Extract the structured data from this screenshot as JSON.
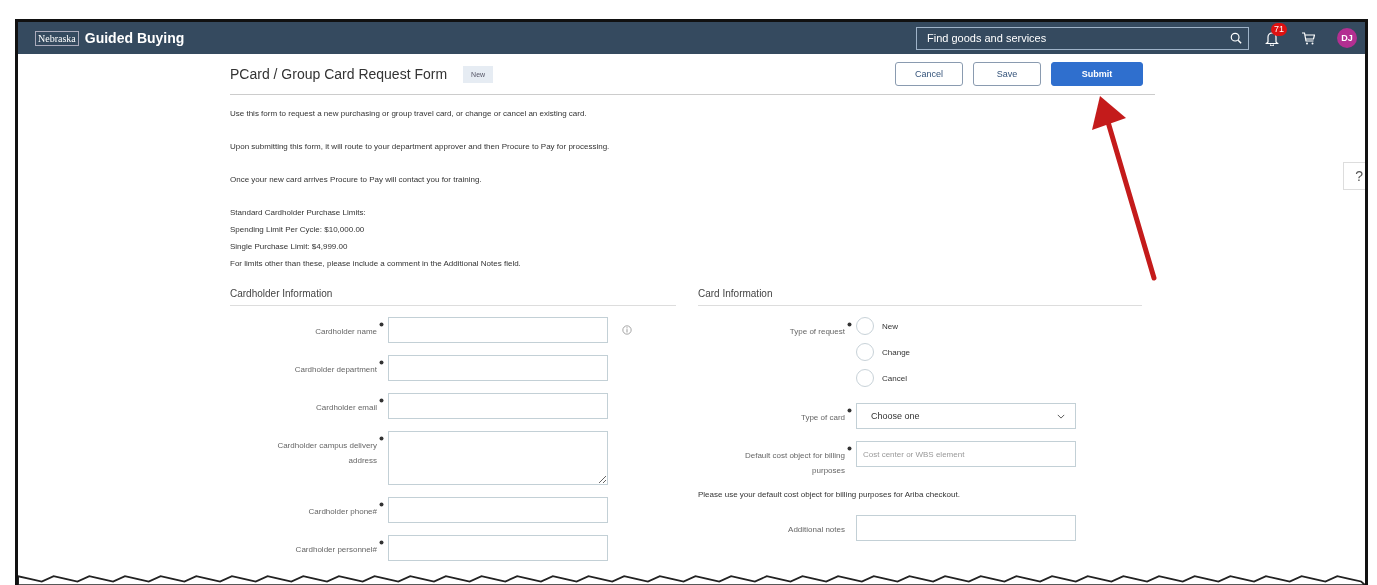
{
  "header": {
    "logo": "Nebraska",
    "app_title": "Guided Buying",
    "search": {
      "placeholder": "Find goods and services"
    },
    "notification_count": "71",
    "avatar": "DJ"
  },
  "form": {
    "title": "PCard / Group Card Request Form",
    "status": "New",
    "buttons": [
      {
        "label": "Cancel",
        "kind": "secondary"
      },
      {
        "label": "Save",
        "kind": "secondary"
      },
      {
        "label": "Submit",
        "kind": "primary"
      }
    ],
    "intro": [
      {
        "lines": [
          "Use this form to request a new purchasing or group travel card, or change or cancel an existing card."
        ]
      },
      {
        "lines": [
          "Upon submitting this form, it will route to your department approver and then Procure to Pay for processing."
        ]
      },
      {
        "lines": [
          "Once your new card arrives Procure to Pay will contact you for training."
        ]
      },
      {
        "lines": [
          "Standard Cardholder Purchase Limits:",
          "Spending Limit Per Cycle: $10,000.00",
          "Single Purchase Limit: $4,999.00",
          "For limits other than these, please include a comment in the Additional Notes field."
        ]
      }
    ],
    "sections": [
      {
        "title": "Cardholder Information",
        "fields": [
          {
            "kind": "text",
            "label": "Cardholder name",
            "required": true,
            "info": true
          },
          {
            "kind": "text",
            "label": "Cardholder department",
            "required": true
          },
          {
            "kind": "text",
            "label": "Cardholder email",
            "required": true
          },
          {
            "kind": "textarea",
            "label": "Cardholder campus delivery address",
            "required": true
          },
          {
            "kind": "text",
            "label": "Cardholder phone#",
            "required": true
          },
          {
            "kind": "text",
            "label": "Cardholder personnel#",
            "required": true
          }
        ]
      },
      {
        "title": "Card Information",
        "fields": [
          {
            "kind": "radio",
            "label": "Type of request",
            "required": true,
            "options": [
              {
                "label": "New",
                "selected": false
              },
              {
                "label": "Change",
                "selected": false
              },
              {
                "label": "Cancel",
                "selected": false
              }
            ]
          },
          {
            "kind": "select",
            "label": "Type of card",
            "required": true,
            "value": "Choose one"
          },
          {
            "kind": "text",
            "label": "Default cost object for billing purposes",
            "required": true,
            "placeholder": "Cost center or WBS element"
          },
          {
            "kind": "note",
            "label": "Please use your default cost object for billing purposes for Ariba checkout."
          },
          {
            "kind": "text",
            "label": "Additional notes",
            "required": false
          }
        ]
      }
    ]
  },
  "help": "?",
  "annotation": {
    "kind": "arrow"
  }
}
